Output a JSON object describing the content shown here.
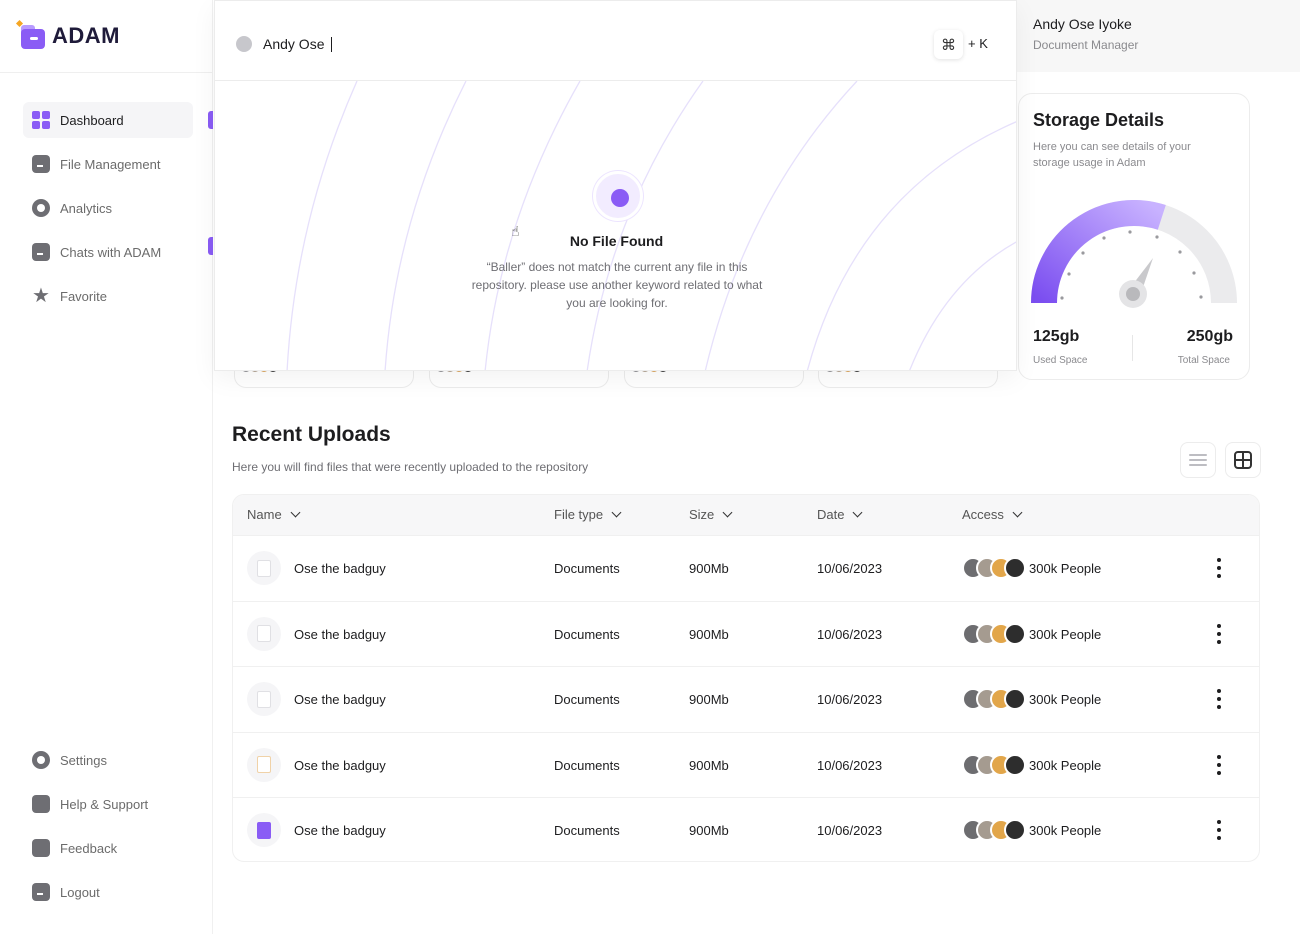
{
  "app": {
    "logo_text": "ADAM"
  },
  "sidebar": {
    "items": [
      {
        "label": "Dashboard",
        "icon": "dashboard-grid-icon",
        "active": true
      },
      {
        "label": "File Management",
        "icon": "folder-icon"
      },
      {
        "label": "Analytics",
        "icon": "analytics-icon"
      },
      {
        "label": "Chats with ADAM",
        "icon": "chat-box-icon"
      },
      {
        "label": "Favorite",
        "icon": "star-icon"
      }
    ],
    "bottom_items": [
      {
        "label": "Settings",
        "icon": "gear-icon"
      },
      {
        "label": "Help & Support",
        "icon": "help-icon"
      },
      {
        "label": "Feedback",
        "icon": "feedback-icon"
      },
      {
        "label": "Logout",
        "icon": "logout-icon"
      }
    ]
  },
  "profile": {
    "name": "Andy Ose Iyoke",
    "role": "Document Manager"
  },
  "search": {
    "value": "Andy Ose",
    "shortcut_icon": "command-icon",
    "shortcut_key": "+ K",
    "empty_title": "No File Found",
    "empty_desc": "“Baller” does not match the current any file in this repository. please use another keyword related to what you are looking for."
  },
  "storage": {
    "title": "Storage Details",
    "desc": "Here you can see details of your storage usage in Adam",
    "used_value": "125gb",
    "used_label": "Used Space",
    "total_value": "250gb",
    "total_label": "Total Space",
    "used_fraction": 0.5,
    "accent": "#8a5cf5"
  },
  "recent": {
    "title": "Recent Uploads",
    "desc": "Here you will find files that were recently uploaded to the repository",
    "columns": [
      "Name",
      "File type",
      "Size",
      "Date",
      "Access"
    ],
    "rows": [
      {
        "name": "Ose the badguy",
        "type": "Documents",
        "size": "900Mb",
        "date": "10/06/2023",
        "access": "300k People"
      },
      {
        "name": "Ose the badguy",
        "type": "Documents",
        "size": "900Mb",
        "date": "10/06/2023",
        "access": "300k People"
      },
      {
        "name": "Ose the badguy",
        "type": "Documents",
        "size": "900Mb",
        "date": "10/06/2023",
        "access": "300k People"
      },
      {
        "name": "Ose the badguy",
        "type": "Documents",
        "size": "900Mb",
        "date": "10/06/2023",
        "access": "300k People"
      },
      {
        "name": "Ose the badguy",
        "type": "Documents",
        "size": "900Mb",
        "date": "10/06/2023",
        "access": "300k People"
      }
    ]
  }
}
